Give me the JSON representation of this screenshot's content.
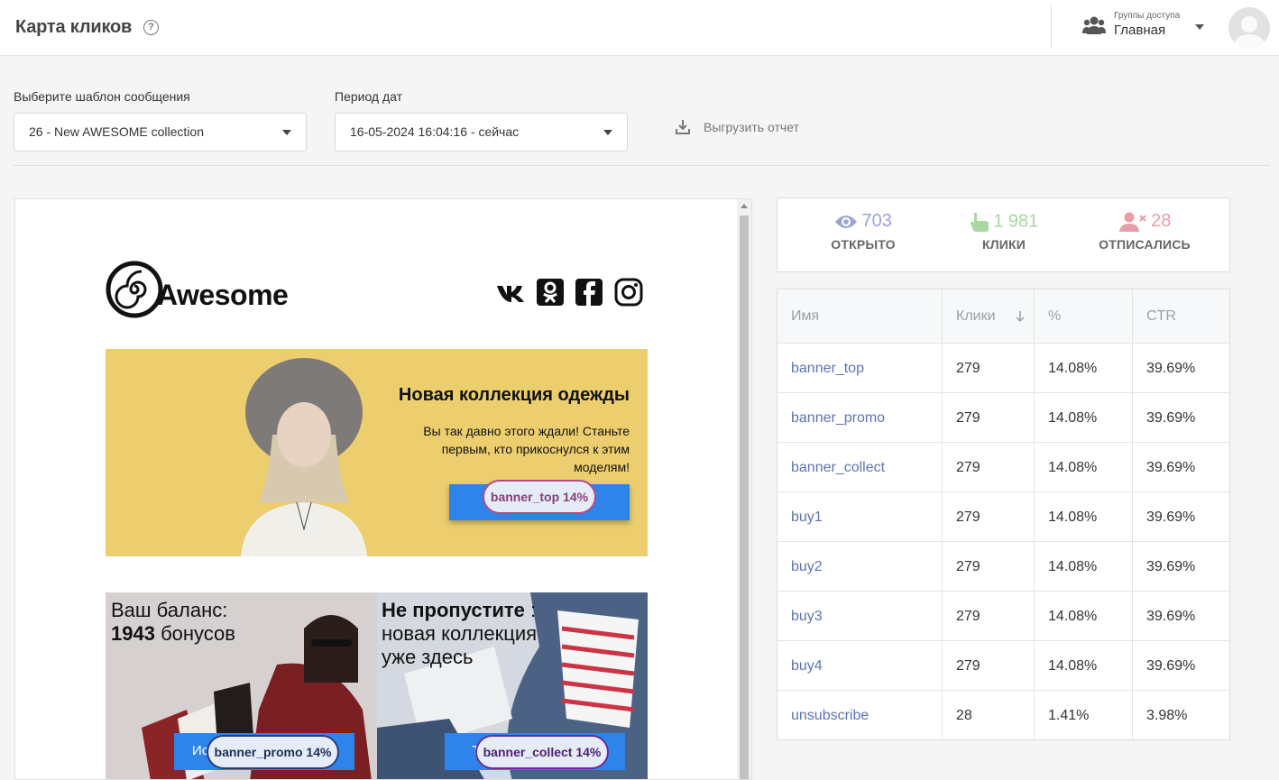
{
  "header": {
    "title": "Карта кликов",
    "help_icon": "?",
    "groups_caption": "Группы доступа",
    "groups_value": "Главная"
  },
  "filters": {
    "template_label": "Выберите шаблон сообщения",
    "template_value": "26 - New AWESOME collection",
    "period_label": "Период дат",
    "period_value": "16-05-2024 16:04:16 - сейчас",
    "export_label": "Выгрузить отчет"
  },
  "email_preview": {
    "logo_text": "Awesome",
    "social_icons": [
      "vk-icon",
      "odnoklassniki-icon",
      "facebook-icon",
      "instagram-icon"
    ],
    "banner_top": {
      "title": "Новая коллекция одежды",
      "text": "Вы так давно этого ждали! Станьте первым, кто прикоснулся к этим моделям!",
      "heat_label": "banner_top 14%"
    },
    "banner_promo": {
      "line1": "Ваш баланс:",
      "bonus_count": "1943",
      "bonus_word": " бонусов",
      "button_fragment": "Ис",
      "heat_label": "banner_promo 14%"
    },
    "banner_collect": {
      "title_bold": "Не пропустите",
      "title_rest": " :",
      "line2": "новая коллекция",
      "line3": "уже здесь",
      "button_fragment": "Т",
      "heat_label": "banner_collect 14%"
    }
  },
  "stats": {
    "opened": {
      "value": "703",
      "label": "ОТКРЫТО",
      "color": "#9aa3d6"
    },
    "clicks": {
      "value": "1 981",
      "label": "КЛИКИ",
      "color": "#a8d8a0"
    },
    "unsubscribed": {
      "value": "28",
      "label": "ОТПИСАЛИСЬ",
      "color": "#e89ea8"
    }
  },
  "table": {
    "headers": [
      "Имя",
      "Клики",
      "%",
      "CTR"
    ],
    "rows": [
      {
        "name": "banner_top",
        "clicks": "279",
        "percent": "14.08%",
        "ctr": "39.69%"
      },
      {
        "name": "banner_promo",
        "clicks": "279",
        "percent": "14.08%",
        "ctr": "39.69%"
      },
      {
        "name": "banner_collect",
        "clicks": "279",
        "percent": "14.08%",
        "ctr": "39.69%"
      },
      {
        "name": "buy1",
        "clicks": "279",
        "percent": "14.08%",
        "ctr": "39.69%"
      },
      {
        "name": "buy2",
        "clicks": "279",
        "percent": "14.08%",
        "ctr": "39.69%"
      },
      {
        "name": "buy3",
        "clicks": "279",
        "percent": "14.08%",
        "ctr": "39.69%"
      },
      {
        "name": "buy4",
        "clicks": "279",
        "percent": "14.08%",
        "ctr": "39.69%"
      },
      {
        "name": "unsubscribe",
        "clicks": "28",
        "percent": "1.41%",
        "ctr": "3.98%"
      }
    ]
  }
}
